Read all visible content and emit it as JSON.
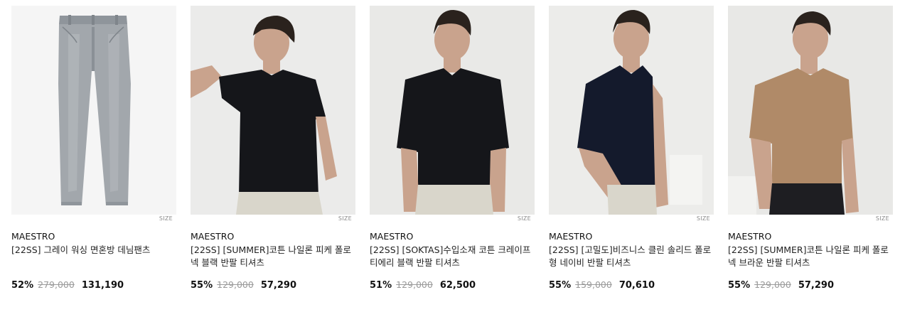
{
  "products": [
    {
      "brand": "MAESTRO",
      "name": "[22SS] 그레이 워싱 면혼방 데님팬츠",
      "discount": "52%",
      "original_price": "279,000",
      "sale_price": "131,190",
      "size_label": "SIZE",
      "image": "grey-denim-pants-image"
    },
    {
      "brand": "MAESTRO",
      "name": "[22SS] [SUMMER]코튼 나일론 피케 폴로넥 블랙 반팔 티셔츠",
      "discount": "55%",
      "original_price": "129,000",
      "sale_price": "57,290",
      "size_label": "SIZE",
      "image": "black-polo-model-image"
    },
    {
      "brand": "MAESTRO",
      "name": "[22SS] [SOKTAS]수입소재 코튼 크레이프 티에리 블랙 반팔 티셔츠",
      "discount": "51%",
      "original_price": "129,000",
      "sale_price": "62,500",
      "size_label": "SIZE",
      "image": "black-crepe-polo-model-image"
    },
    {
      "brand": "MAESTRO",
      "name": "[22SS] [고밀도]비즈니스 클린 솔리드 폴로형 네이비 반팔 티셔츠",
      "discount": "55%",
      "original_price": "159,000",
      "sale_price": "70,610",
      "size_label": "SIZE",
      "image": "navy-polo-model-image"
    },
    {
      "brand": "MAESTRO",
      "name": "[22SS] [SUMMER]코튼 나일론 피케 폴로넥 브라운 반팔 티셔츠",
      "discount": "55%",
      "original_price": "129,000",
      "sale_price": "57,290",
      "size_label": "SIZE",
      "image": "brown-polo-model-image"
    }
  ],
  "colors": {
    "grey_denim": "#9ea3a8",
    "black_polo": "#15161a",
    "navy_polo": "#141a2c",
    "brown_polo": "#b08a68",
    "chino": "#d9d6cb",
    "skin": "#c9a38d",
    "hair": "#2a221d"
  }
}
